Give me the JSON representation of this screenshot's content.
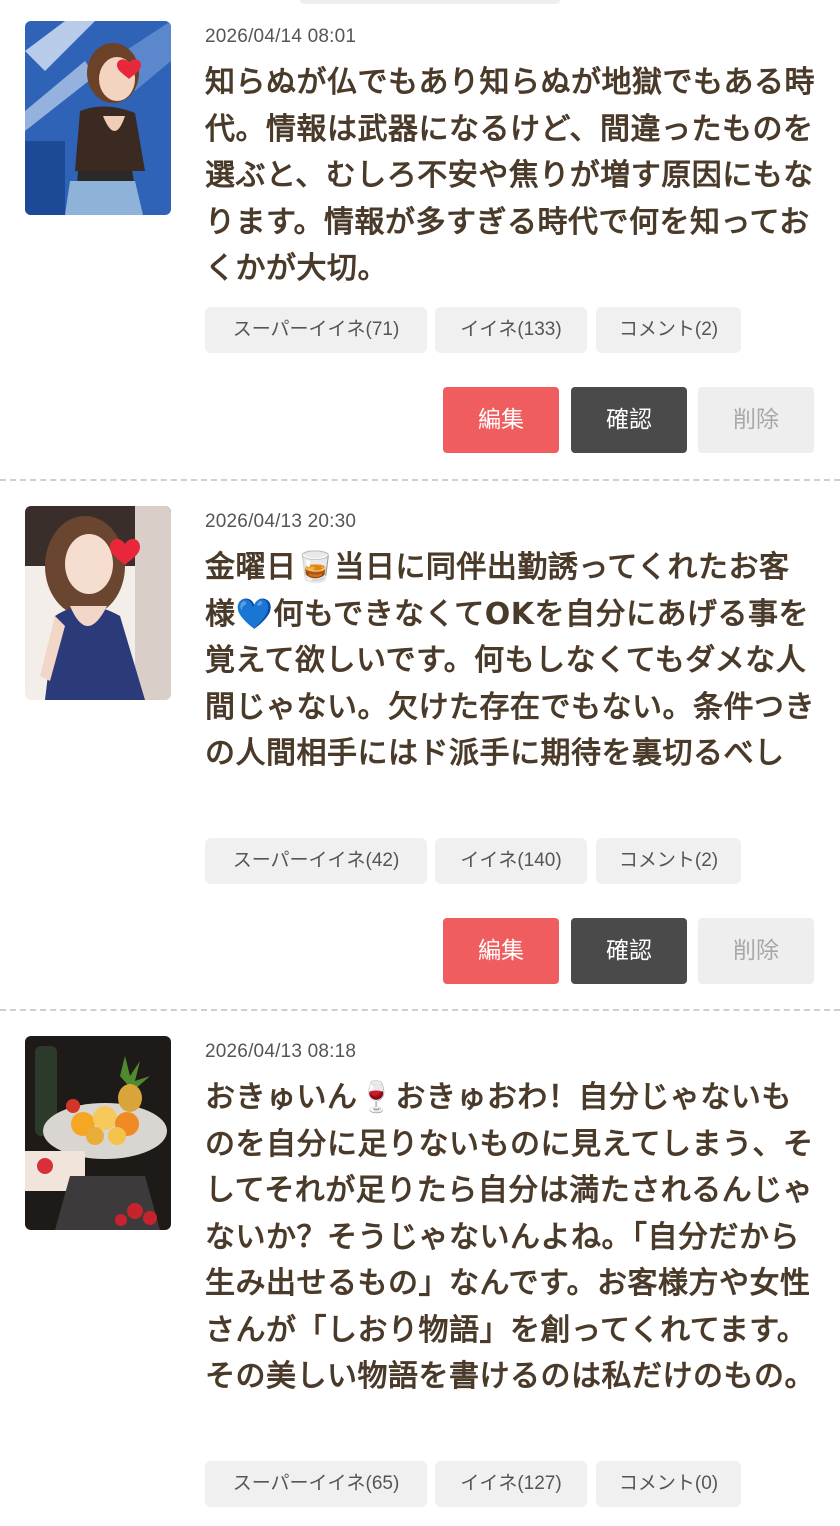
{
  "posts": [
    {
      "date": "2026/04/14 08:01",
      "body": "知らぬが仏でもあり知らぬが地獄でもある時代。情報は武器になるけど、間違ったものを選ぶと、むしろ不安や焦りが増す原因にもなります。情報が多すぎる時代で何を知っておくかが大切。",
      "super_like": "スーパーイイネ(71)",
      "like": "イイネ(133)",
      "comment": "コメント(2)",
      "edit": "編集",
      "confirm": "確認",
      "delete": "削除"
    },
    {
      "date": "2026/04/13 20:30",
      "body": "金曜日🥃当日に同伴出勤誘ってくれたお客様💙何もできなくてOKを自分にあげる事を覚えて欲しいです。何もしなくてもダメな人間じゃない。欠けた存在でもない。条件つきの人間相手にはド派手に期待を裏切るべし",
      "super_like": "スーパーイイネ(42)",
      "like": "イイネ(140)",
      "comment": "コメント(2)",
      "edit": "編集",
      "confirm": "確認",
      "delete": "削除"
    },
    {
      "date": "2026/04/13 08:18",
      "body": "おきゅいん🍷おきゅおわ！自分じゃないものを自分に足りないものに見えてしまう、そしてそれが足りたら自分は満たされるんじゃないか？そうじゃないんよね。「自分だから生み出せるもの」なんです。お客様方や女性さんが「しおり物語」を創ってくれてます。その美しい物語を書けるのは私だけのもの。",
      "super_like": "スーパーイイネ(65)",
      "like": "イイネ(127)",
      "comment": "コメント(0)"
    }
  ]
}
